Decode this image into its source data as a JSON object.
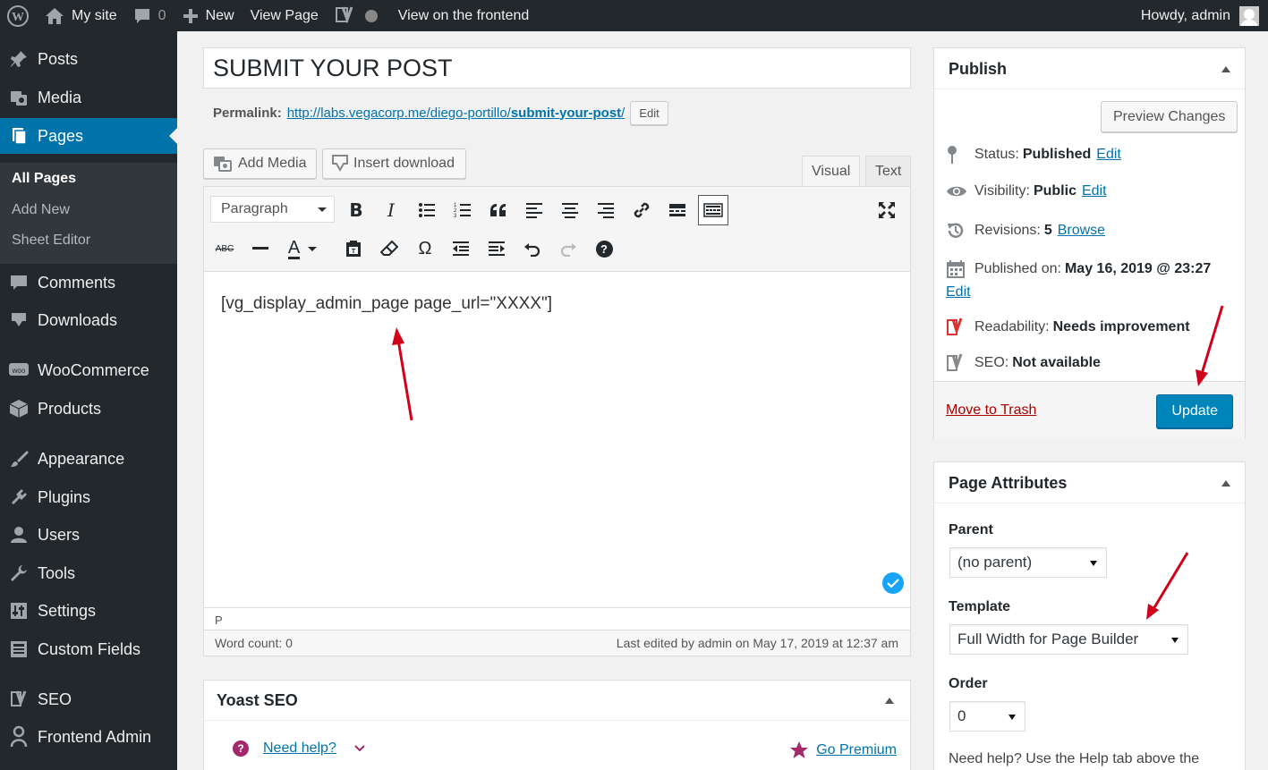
{
  "adminbar": {
    "site": "My site",
    "comments": "0",
    "new": "New",
    "view_page": "View Page",
    "view_frontend": "View on the frontend",
    "howdy": "Howdy, admin"
  },
  "sidebar": {
    "items": [
      {
        "label": "Posts"
      },
      {
        "label": "Media"
      },
      {
        "label": "Pages"
      },
      {
        "label": "Comments"
      },
      {
        "label": "Downloads"
      },
      {
        "label": "WooCommerce"
      },
      {
        "label": "Products"
      },
      {
        "label": "Appearance"
      },
      {
        "label": "Plugins"
      },
      {
        "label": "Users"
      },
      {
        "label": "Tools"
      },
      {
        "label": "Settings"
      },
      {
        "label": "Custom Fields"
      },
      {
        "label": "SEO"
      },
      {
        "label": "Frontend Admin"
      }
    ],
    "submenu": [
      "All Pages",
      "Add New",
      "Sheet Editor"
    ]
  },
  "post": {
    "title": "SUBMIT YOUR POST",
    "permalink_label": "Permalink:",
    "permalink_base": "http://labs.vegacorp.me/diego-portillo/",
    "permalink_slug": "submit-your-post",
    "permalink_trail": "/",
    "edit_label": "Edit"
  },
  "media": {
    "add_media": "Add Media",
    "insert_download": "Insert download"
  },
  "editor": {
    "tab_visual": "Visual",
    "tab_text": "Text",
    "format": "Paragraph",
    "content": "[vg_display_admin_page page_url=\"XXXX\"]",
    "path": "P",
    "word_count": "Word count: 0",
    "last_edited": "Last edited by admin on May 17, 2019 at 12:37 am",
    "text_color_glyph": "A",
    "strike_glyph": "ABC",
    "omega_glyph": "Ω",
    "help_glyph": "?"
  },
  "yoast": {
    "title": "Yoast SEO",
    "need_help": "Need help?",
    "go_premium": "Go Premium"
  },
  "publish": {
    "title": "Publish",
    "preview": "Preview Changes",
    "status_label": "Status:",
    "status_value": "Published",
    "visibility_label": "Visibility:",
    "visibility_value": "Public",
    "revisions_label": "Revisions:",
    "revisions_value": "5",
    "browse": "Browse",
    "published_label": "Published on:",
    "published_value": "May 16, 2019 @ 23:27",
    "edit": "Edit",
    "readability_label": "Readability:",
    "readability_value": "Needs improvement",
    "seo_label": "SEO:",
    "seo_value": "Not available",
    "trash": "Move to Trash",
    "update": "Update"
  },
  "attributes": {
    "title": "Page Attributes",
    "parent_label": "Parent",
    "parent_value": "(no parent)",
    "template_label": "Template",
    "template_value": "Full Width for Page Builder",
    "order_label": "Order",
    "order_value": "0",
    "help_text": "Need help? Use the Help tab above the"
  },
  "colors": {
    "accent": "#0073aa",
    "adminbar": "#23282d",
    "update_button": "#0085ba",
    "trash": "#a00",
    "arrow": "#d0021b"
  }
}
